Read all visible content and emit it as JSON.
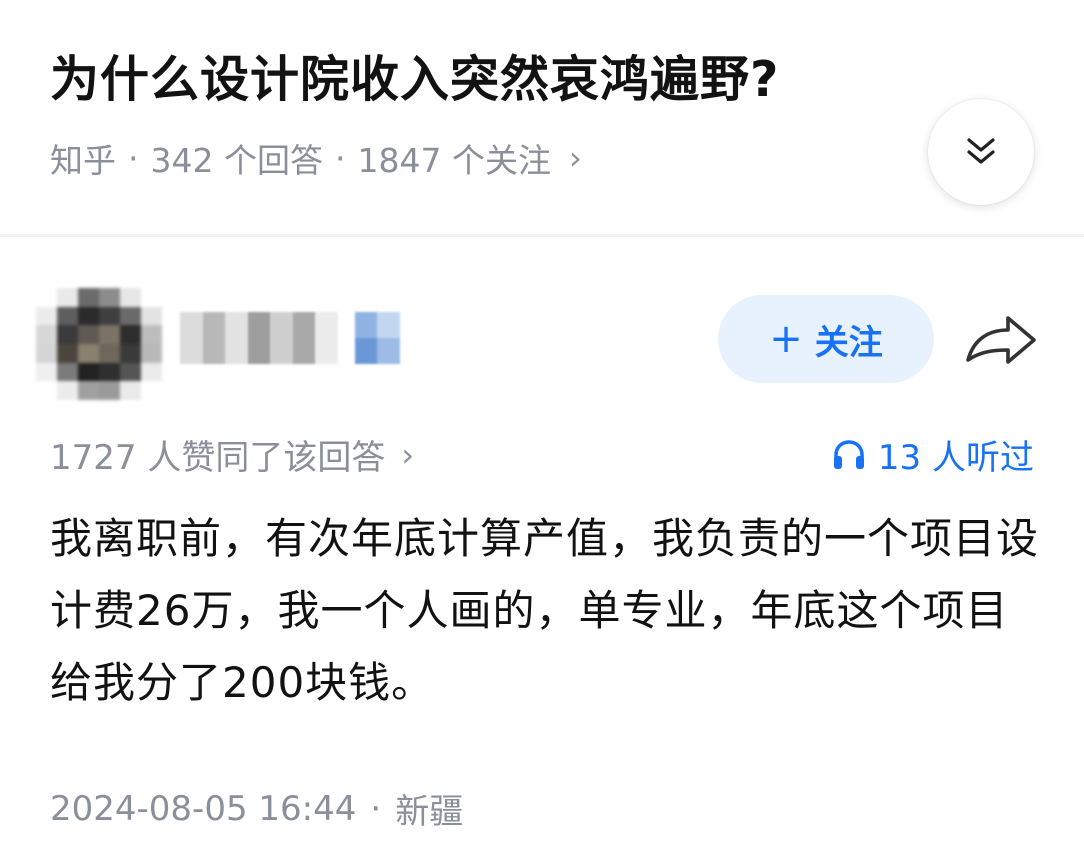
{
  "question": {
    "title": "为什么设计院收入突然哀鸿遍野?",
    "source": "知乎",
    "answers": "342 个回答",
    "follows": "1847 个关注",
    "chevron": "›"
  },
  "author": {
    "follow_plus": "+",
    "follow_label": "关注"
  },
  "stats": {
    "likes": "1727 人赞同了该回答",
    "chevron": "›",
    "listens": "13 人听过"
  },
  "answer": {
    "content": "我离职前，有次年底计算产值，我负责的一个项目设计费26万，我一个人画的，单专业，年底这个项目给我分了200块钱。",
    "datetime": "2024-08-05 16:44",
    "location": "新疆"
  },
  "separator": "·",
  "colors": {
    "accent": "#1772f6",
    "meta_gray": "#8a8f99",
    "follow_bg": "#e8f1fe"
  },
  "icons": {
    "expand": "chevrons-down-icon",
    "share": "share-arrow-icon",
    "listen": "headphones-icon"
  }
}
